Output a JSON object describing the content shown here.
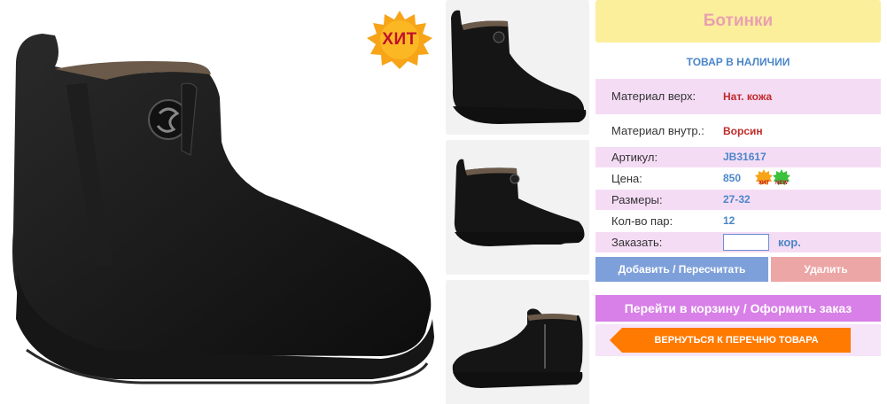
{
  "product": {
    "title": "Ботинки",
    "stock_status": "ТОВАР В НАЛИЧИИ",
    "badge": "ХИТ",
    "attributes": [
      {
        "label": "Материал верх:",
        "value": "Нат. кожа"
      },
      {
        "label": "Материал внутр.:",
        "value": "Ворсин"
      },
      {
        "label": "Артикул:",
        "value": "JB31617"
      },
      {
        "label": "Цена:",
        "value": "850"
      },
      {
        "label": "Размеры:",
        "value": "27-32"
      },
      {
        "label": "Кол-во пар:",
        "value": "12"
      }
    ],
    "price_badges": [
      "ХИТ",
      "NEW"
    ],
    "order": {
      "label": "Заказать:",
      "quantity_value": "",
      "unit": "кор."
    }
  },
  "actions": {
    "add_label": "Добавить / Пересчитать",
    "delete_label": "Удалить",
    "cart_label": "Перейти в корзину / Оформить заказ",
    "back_label": "ВЕРНУТЬСЯ К ПЕРЕЧНЮ ТОВАРА"
  },
  "colors": {
    "title_bg": "#fbef9c",
    "title_text": "#e9a0b0",
    "accent_blue": "#4b86c8",
    "value_red": "#c02a2a",
    "row_pink": "#f5dcf5",
    "add_button": "#7ea0da",
    "delete_button": "#eda6a6",
    "cart_button": "#d87fe8",
    "back_button": "#ff7a00",
    "badge_gold": "#f7a418"
  },
  "icons": {
    "hit_badge": "starburst-badge-icon",
    "new_badge": "new-badge-icon",
    "back_arrow": "arrow-left-icon"
  }
}
